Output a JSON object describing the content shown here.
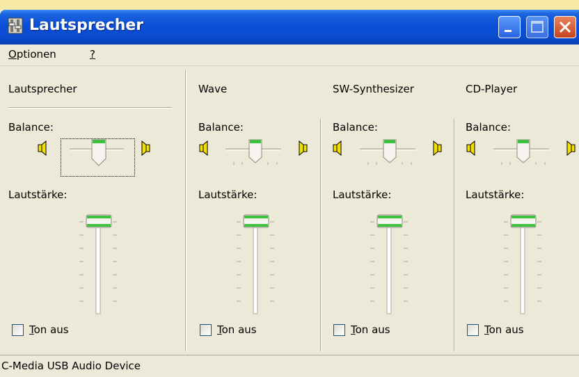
{
  "window": {
    "title": "Lautsprecher",
    "icon": "speaker-app-icon"
  },
  "menu": {
    "options_label": "Optionen",
    "help_label": "?"
  },
  "channels": [
    {
      "name": "Lautsprecher",
      "balance_label": "Balance:",
      "volume_label": "Lautstärke:",
      "mute_label": "Ton aus",
      "muted": false,
      "balance": 0.5,
      "volume": 1.0
    },
    {
      "name": "Wave",
      "balance_label": "Balance:",
      "volume_label": "Lautstärke:",
      "mute_label": "Ton aus",
      "muted": false,
      "balance": 0.5,
      "volume": 1.0
    },
    {
      "name": "SW-Synthesizer",
      "balance_label": "Balance:",
      "volume_label": "Lautstärke:",
      "mute_label": "Ton aus",
      "muted": false,
      "balance": 0.5,
      "volume": 1.0
    },
    {
      "name": "CD-Player",
      "balance_label": "Balance:",
      "volume_label": "Lautstärke:",
      "mute_label": "Ton aus",
      "muted": false,
      "balance": 0.5,
      "volume": 1.0
    }
  ],
  "status": {
    "device": "C-Media USB Audio Device"
  },
  "colors": {
    "titlebar": "#0a4fd6",
    "window_bg": "#ece9d8",
    "thumb_green": "#3fc13f",
    "speaker_yellow": "#f2e000"
  }
}
